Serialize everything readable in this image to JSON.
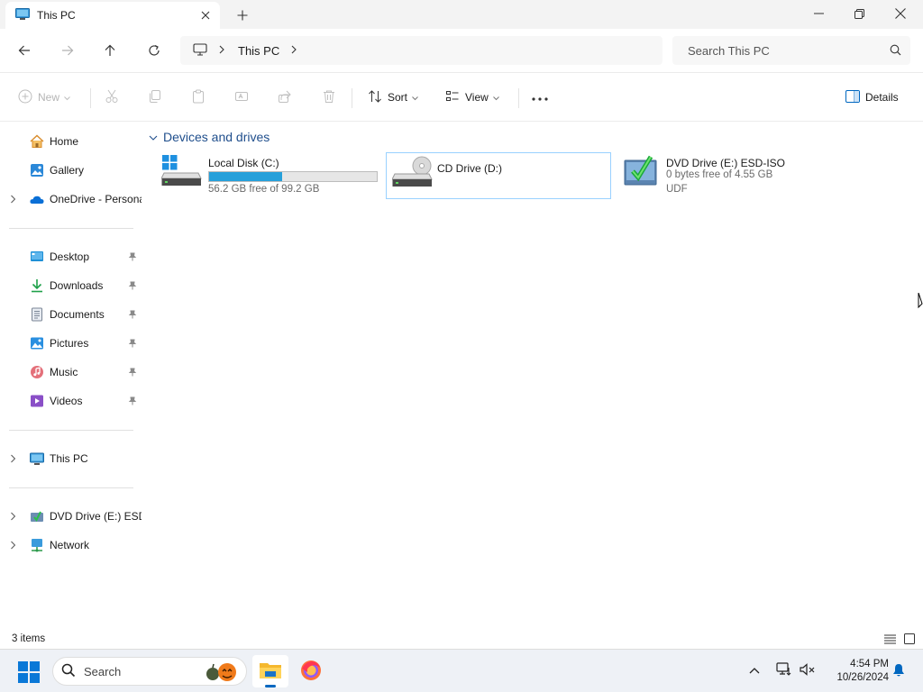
{
  "window": {
    "tab_title": "This PC",
    "minimize_icon": "minimize-icon",
    "maximize_icon": "restore-icon",
    "close_icon": "close-icon"
  },
  "address": {
    "location": "This PC",
    "search_placeholder": "Search This PC"
  },
  "commands": {
    "new_label": "New",
    "sort_label": "Sort",
    "view_label": "View",
    "details_label": "Details"
  },
  "sidebar": {
    "quick": [
      {
        "label": "Home",
        "icon": "home-icon"
      },
      {
        "label": "Gallery",
        "icon": "gallery-icon"
      },
      {
        "label": "OneDrive - Personal",
        "icon": "onedrive-icon"
      }
    ],
    "pinned": [
      {
        "label": "Desktop",
        "icon": "desktop-folder-icon"
      },
      {
        "label": "Downloads",
        "icon": "downloads-folder-icon"
      },
      {
        "label": "Documents",
        "icon": "documents-folder-icon"
      },
      {
        "label": "Pictures",
        "icon": "pictures-folder-icon"
      },
      {
        "label": "Music",
        "icon": "music-folder-icon"
      },
      {
        "label": "Videos",
        "icon": "videos-folder-icon"
      }
    ],
    "this_pc": "This PC",
    "dvd_drive": "DVD Drive (E:) ESD-ISO",
    "network": "Network"
  },
  "content": {
    "group_title": "Devices and drives",
    "drives": [
      {
        "name": "Local Disk (C:)",
        "free_text": "56.2 GB free of 99.2 GB",
        "used_fraction": 0.433,
        "icon": "windows-drive-icon"
      },
      {
        "name": "CD Drive (D:)",
        "icon": "cd-drive-icon"
      },
      {
        "name": "DVD Drive (E:) ESD-ISO",
        "free_text": "0 bytes free of 4.55 GB",
        "filesystem": "UDF",
        "icon": "dvd-drive-icon"
      }
    ]
  },
  "status": {
    "item_count": "3 items"
  },
  "taskbar": {
    "search_placeholder": "Search",
    "time": "4:54 PM",
    "date": "10/26/2024"
  },
  "colors": {
    "accent": "#0067c0",
    "progress_fill": "#26a0da",
    "selection_border": "#99d1ff",
    "group_header": "#1f4e8c"
  }
}
